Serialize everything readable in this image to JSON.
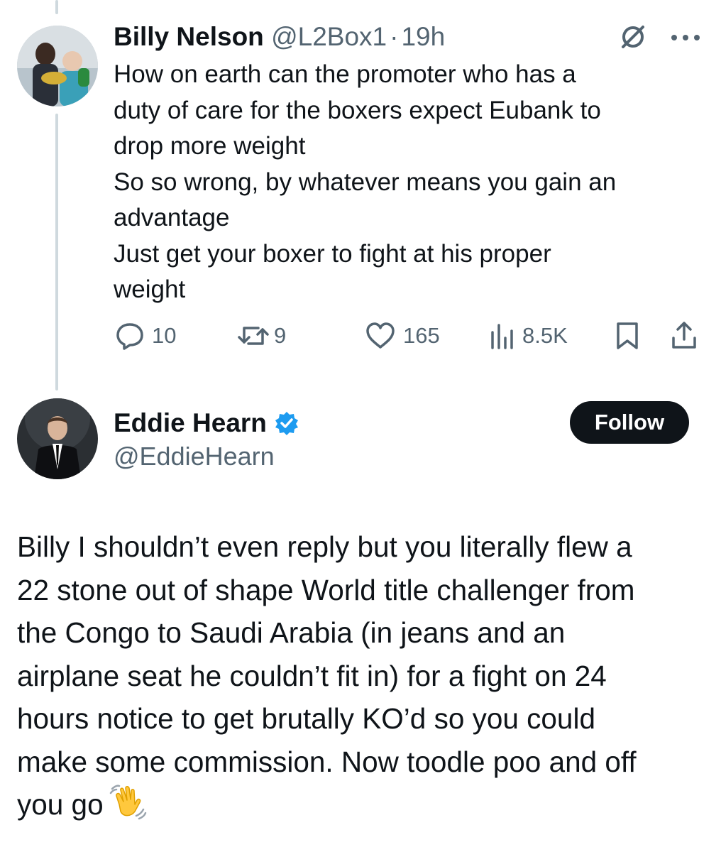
{
  "reply_tweet": {
    "author_name": "Billy Nelson",
    "handle": "@L2Box1",
    "separator": "·",
    "time": "19h",
    "text_lines": [
      "How on earth can the promoter who has a",
      "duty of care for the boxers expect Eubank to",
      "drop more weight",
      "So so wrong, by whatever means you gain an",
      "advantage",
      "Just get your boxer to fight at his proper",
      "weight"
    ],
    "stats": {
      "replies": "10",
      "reposts": "9",
      "likes": "165",
      "views": "8.5K"
    }
  },
  "main_tweet": {
    "author_name": "Eddie Hearn",
    "handle": "@EddieHearn",
    "follow_label": "Follow",
    "text_lines": [
      "Billy I shouldn’t even reply but you literally flew a",
      "22 stone out of shape World title challenger from",
      "the Congo to Saudi Arabia (in jeans and an",
      "airplane seat he couldn’t fit in) for a fight on 24",
      "hours notice to get brutally KO’d so you could",
      "make some commission. Now toodle poo and off",
      "you go"
    ],
    "emoji": "waving-hand"
  },
  "icons": [
    "grok-icon",
    "more-icon",
    "reply-icon",
    "repost-icon",
    "like-icon",
    "views-icon",
    "bookmark-icon",
    "share-icon",
    "verified-badge-icon",
    "waving-hand-emoji"
  ],
  "colors": {
    "text": "#0f1419",
    "muted": "#536471",
    "verified": "#1d9bf0",
    "follow_bg": "#0f1419",
    "thread_line": "#cfd9de"
  }
}
